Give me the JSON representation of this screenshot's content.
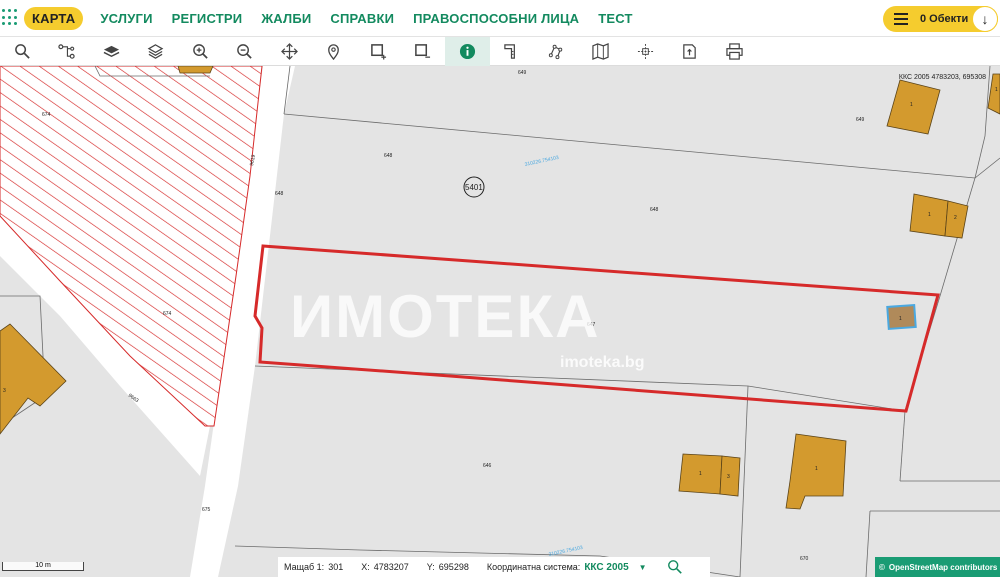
{
  "nav": {
    "items": [
      {
        "label": "КАРТА",
        "active": true
      },
      {
        "label": "УСЛУГИ"
      },
      {
        "label": "РЕГИСТРИ"
      },
      {
        "label": "ЖАЛБИ"
      },
      {
        "label": "СПРАВКИ"
      },
      {
        "label": "ПРАВОСПОСОБНИ ЛИЦА"
      },
      {
        "label": "ТЕСТ"
      }
    ],
    "objects_label": "0 Обекти"
  },
  "toolbar": {
    "tools": [
      "search-icon",
      "route-icon",
      "layers-icon",
      "layers-stack-icon",
      "zoom-in-icon",
      "zoom-out-icon",
      "pan-icon",
      "location-pin-icon",
      "select-rectangle-add-icon",
      "select-rectangle-remove-icon",
      "info-icon",
      "measure-distance-icon",
      "measure-area-icon",
      "map-book-icon",
      "crosshair-coordinates-icon",
      "export-icon",
      "print-icon"
    ],
    "active_tool": "info-icon"
  },
  "map": {
    "coordinate_readout": "ККС 2005 4783203, 695308",
    "parcel_numbers": [
      "649",
      "674",
      "9619",
      "648",
      "5401",
      "648",
      "649",
      "648",
      "647",
      "646",
      "9663",
      "674",
      "675",
      "670",
      "649"
    ],
    "building_labels": [
      "1",
      "1",
      "2",
      "1",
      "3",
      "1",
      "3",
      "1",
      "1"
    ],
    "cadastral_ids": [
      "310226.754103",
      "310226.754103"
    ],
    "colors": {
      "map_bg": "#e4e4e4",
      "selected_parcel": "#d62a2a",
      "building": "#d39a2e",
      "highlight_building": "#4aa8e0",
      "road": "#ffffff",
      "hatch": "#d62a2a"
    }
  },
  "watermark": {
    "brand": "ИМОТЕКА",
    "url": "imoteka.bg"
  },
  "statusbar": {
    "scale_label": "Мащаб 1:",
    "scale_value": "301",
    "x_label": "X:",
    "x_value": "4783207",
    "y_label": "Y:",
    "y_value": "695298",
    "crs_label": "Координатна система:",
    "crs_value": "ККС 2005"
  },
  "scalebar": {
    "label": "10 m"
  },
  "attribution": {
    "text": "OpenStreetMap  contributors"
  }
}
